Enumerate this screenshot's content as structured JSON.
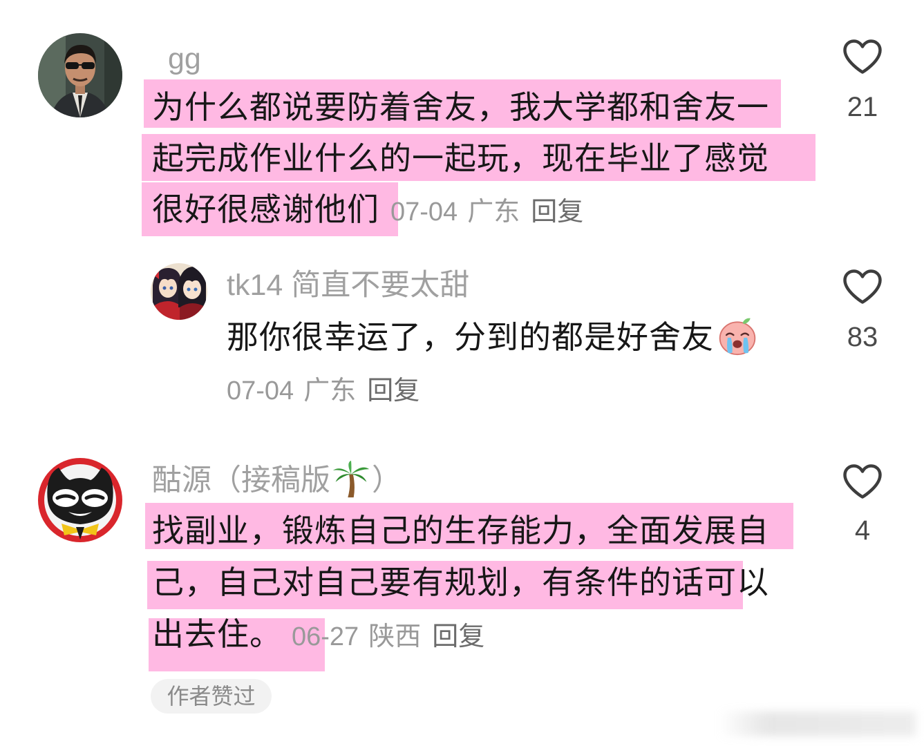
{
  "comments": [
    {
      "username": "gg",
      "avatar_icon": "avatar-man-sunglasses-icon",
      "lines": [
        "为什么都说要防着舍友，我大学都和舍友一",
        "起完成作业什么的一起玩，现在毕业了感觉",
        "很好很感谢他们"
      ],
      "date": "07-04",
      "location": "广东",
      "reply_label": "回复",
      "like_icon": "heart-outline-icon",
      "likes": "21",
      "replies": [
        {
          "username": "tk14 简直不要太甜",
          "avatar_icon": "avatar-anime-girls-icon",
          "text": "那你很幸运了，分到的都是好舍友",
          "emoji_icon": "crying-face-emoji-icon",
          "date": "07-04",
          "location": "广东",
          "reply_label": "回复",
          "like_icon": "heart-outline-icon",
          "likes": "83"
        }
      ]
    },
    {
      "username_parts": {
        "before_emoji": "酤源（接稿版",
        "emoji_icon": "palm-tree-emoji-icon",
        "after_emoji": "）"
      },
      "avatar_icon": "avatar-black-cat-icon",
      "lines": [
        "找副业，锻炼自己的生存能力，全面发展自",
        "己，自己对自己要有规划，有条件的话可以",
        "出去住。"
      ],
      "date": "06-27",
      "location": "陕西",
      "reply_label": "回复",
      "like_icon": "heart-outline-icon",
      "likes": "4",
      "author_liked_badge": "作者赞过"
    }
  ],
  "colors": {
    "highlight": "#ffb9e3",
    "text": "#171717",
    "username": "#a0a0a0",
    "meta": "#999999",
    "reply_label": "#6b6b6b",
    "badge_bg": "#f2f2f2",
    "badge_text": "#8a8a8a",
    "icon_stroke": "#3d3d3d",
    "count": "#4a4a4a"
  }
}
